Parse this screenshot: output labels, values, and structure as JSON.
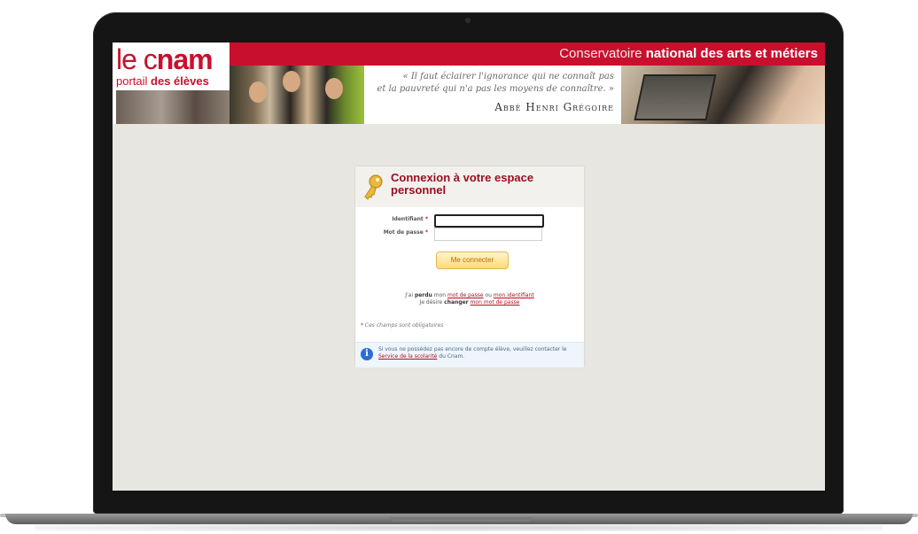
{
  "header": {
    "logo_main_light": "le c",
    "logo_main_bold": "nam",
    "logo_sub_light": "portail ",
    "logo_sub_bold": "des élèves",
    "institution_light": "Conservatoire ",
    "institution_bold": "national des arts et métiers",
    "quote_line1": "« Il faut éclairer l'ignorance qui ne connaît pas",
    "quote_line2": "et la pauvreté qui n'a pas les moyens de connaître. »",
    "quote_author": "Abbé Henri Grégoire"
  },
  "login": {
    "title": "Connexion à votre espace personnel",
    "identifiant_label": "Identifiant",
    "password_label": "Mot de passe",
    "required_mark": "*",
    "identifiant_value": "",
    "password_value": "",
    "submit_label": "Me connecter",
    "lost_prefix": "J'ai ",
    "lost_bold": "perdu",
    "lost_mid": " mon ",
    "lost_link_password": "mot de passe",
    "lost_or": " ou ",
    "lost_link_id": "mon identifiant",
    "change_prefix": "Je désire ",
    "change_bold": "changer",
    "change_link": "mon mot de passe",
    "required_note": "Ces champs sont obligatoires",
    "info_text_1": "Si vous ne possédez pas encore de compte élève, veuillez contacter le ",
    "info_link": "Service de la scolarité",
    "info_text_2": " du Cnam.",
    "info_icon_glyph": "i"
  },
  "colors": {
    "brand_red": "#c8102e",
    "title_red": "#9b0d1f",
    "page_bg": "#e8e6e1"
  },
  "icons": [
    "key-icon",
    "info-icon"
  ]
}
